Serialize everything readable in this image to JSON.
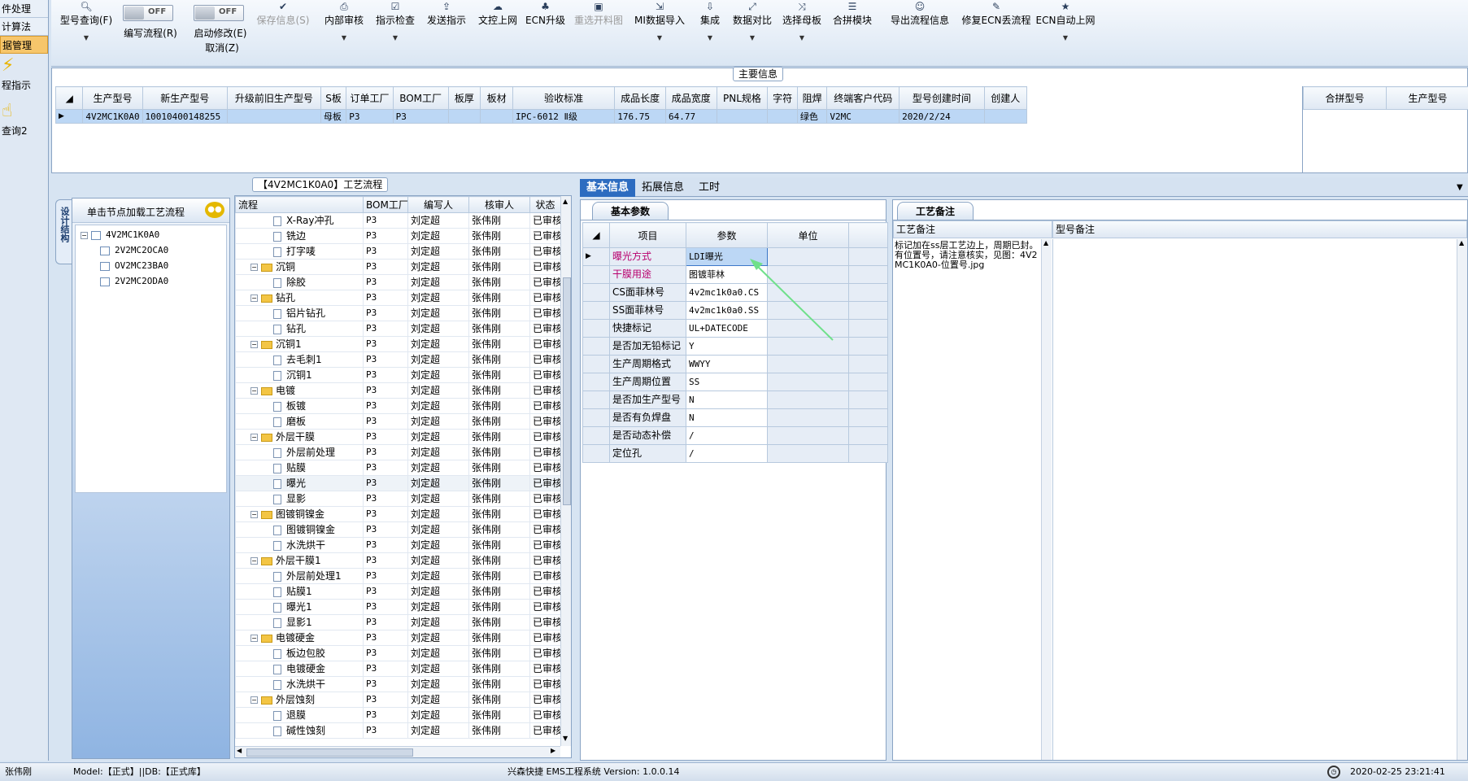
{
  "left_nav": {
    "items": [
      "件处理",
      "计算法",
      "据管理"
    ],
    "icon_items": [
      "程指示",
      "查询2"
    ]
  },
  "toolbar": {
    "query": "型号查询(F)",
    "write_flow": "编写流程(R)",
    "auto_modify": "启动修改(E)",
    "cancel": "取消(Z)",
    "save_info": "保存信息(S)",
    "internal_review": "内部审核",
    "indicator_check": "指示检查",
    "send_indicator": "发送指示",
    "text_upload": "文控上网",
    "ecn_upgrade": "ECN升级",
    "reselect_image": "重选开料图",
    "mi_import": "MI数据导入",
    "integrate": "集成",
    "data_compare": "数据对比",
    "select_mother": "选择母板",
    "merge_module": "合拼模块",
    "export_flow": "导出流程信息",
    "fix_ecn": "修复ECN丢流程",
    "ecn_auto": "ECN自动上网",
    "toggle_off": "OFF"
  },
  "main_info": {
    "title": "主要信息",
    "columns": [
      "生产型号",
      "新生产型号",
      "升级前旧生产型号",
      "S板",
      "订单工厂",
      "BOM工厂",
      "板厚",
      "板材",
      "验收标准",
      "成品长度",
      "成品宽度",
      "PNL规格",
      "字符",
      "阻焊",
      "终端客户代码",
      "型号创建时间",
      "创建人"
    ],
    "row": [
      "4V2MC1K0A0",
      "10010400148255",
      "",
      "母板",
      "P3",
      "P3",
      "",
      "",
      "IPC-6012 Ⅱ级",
      "176.75",
      "64.77",
      "",
      "",
      "绿色",
      "V2MC",
      "2020/2/24",
      ""
    ],
    "merge_columns": [
      "合拼型号",
      "生产型号"
    ]
  },
  "process": {
    "title": "【4V2MC1K0A0】工艺流程",
    "side_tab": "设计结构",
    "hint": "单击节点加载工艺流程",
    "tree": [
      "4V2MC1K0A0",
      "2V2MC2OCA0",
      "OV2MC23BA0",
      "2V2MC2ODA0"
    ],
    "columns": [
      "流程",
      "BOM工厂",
      "编写人",
      "核审人",
      "状态"
    ],
    "rows": [
      {
        "name": "X-Ray冲孔",
        "level": 1,
        "folder": false
      },
      {
        "name": "铣边",
        "level": 1,
        "folder": false
      },
      {
        "name": "打字唛",
        "level": 1,
        "folder": false
      },
      {
        "name": "沉铜",
        "level": 0,
        "folder": true
      },
      {
        "name": "除胶",
        "level": 1,
        "folder": false
      },
      {
        "name": "钻孔",
        "level": 0,
        "folder": true
      },
      {
        "name": "铝片钻孔",
        "level": 1,
        "folder": false
      },
      {
        "name": "钻孔",
        "level": 1,
        "folder": false
      },
      {
        "name": "沉铜1",
        "level": 0,
        "folder": true
      },
      {
        "name": "去毛刺1",
        "level": 1,
        "folder": false
      },
      {
        "name": "沉铜1",
        "level": 1,
        "folder": false
      },
      {
        "name": "电镀",
        "level": 0,
        "folder": true
      },
      {
        "name": "板镀",
        "level": 1,
        "folder": false
      },
      {
        "name": "磨板",
        "level": 1,
        "folder": false
      },
      {
        "name": "外层干膜",
        "level": 0,
        "folder": true
      },
      {
        "name": "外层前处理",
        "level": 1,
        "folder": false
      },
      {
        "name": "贴膜",
        "level": 1,
        "folder": false
      },
      {
        "name": "曝光",
        "level": 1,
        "folder": false
      },
      {
        "name": "显影",
        "level": 1,
        "folder": false
      },
      {
        "name": "图镀铜镍金",
        "level": 0,
        "folder": true
      },
      {
        "name": "图镀铜镍金",
        "level": 1,
        "folder": false
      },
      {
        "name": "水洗烘干",
        "level": 1,
        "folder": false
      },
      {
        "name": "外层干膜1",
        "level": 0,
        "folder": true
      },
      {
        "name": "外层前处理1",
        "level": 1,
        "folder": false
      },
      {
        "name": "贴膜1",
        "level": 1,
        "folder": false
      },
      {
        "name": "曝光1",
        "level": 1,
        "folder": false
      },
      {
        "name": "显影1",
        "level": 1,
        "folder": false
      },
      {
        "name": "电镀硬金",
        "level": 0,
        "folder": true
      },
      {
        "name": "板边包胶",
        "level": 1,
        "folder": false
      },
      {
        "name": "电镀硬金",
        "level": 1,
        "folder": false
      },
      {
        "name": "水洗烘干",
        "level": 1,
        "folder": false
      },
      {
        "name": "外层蚀刻",
        "level": 0,
        "folder": true
      },
      {
        "name": "退膜",
        "level": 1,
        "folder": false
      },
      {
        "name": "碱性蚀刻",
        "level": 1,
        "folder": false
      }
    ],
    "bom": "P3",
    "writer": "刘定超",
    "reviewer": "张伟刚",
    "status": "已审核"
  },
  "right_tabs": [
    "基本信息",
    "拓展信息",
    "工时"
  ],
  "basic": {
    "tab": "基本参数",
    "columns": [
      "项目",
      "参数",
      "单位"
    ],
    "rows": [
      [
        "曝光方式",
        "LDI曝光",
        ""
      ],
      [
        "干膜用途",
        "图镀菲林",
        ""
      ],
      [
        "CS面菲林号",
        "4v2mc1k0a0.CS",
        ""
      ],
      [
        "SS面菲林号",
        "4v2mc1k0a0.SS",
        ""
      ],
      [
        "快捷标记",
        "UL+DATECODE",
        ""
      ],
      [
        "是否加无铅标记",
        "Y",
        ""
      ],
      [
        "生产周期格式",
        "WWYY",
        ""
      ],
      [
        "生产周期位置",
        "SS",
        ""
      ],
      [
        "是否加生产型号",
        "N",
        ""
      ],
      [
        "是否有负焊盘",
        "N",
        ""
      ],
      [
        "是否动态补偿",
        "/",
        ""
      ],
      [
        "定位孔",
        "/",
        ""
      ]
    ]
  },
  "notes": {
    "tab": "工艺备注",
    "col1": "工艺备注",
    "col2": "型号备注",
    "text": "标记加在ss层工艺边上，周期已封。有位置号，请注意核实，见图：4V2MC1K0A0-位置号.jpg"
  },
  "status": {
    "user": "张伟刚",
    "model": "Model:【正式】||DB:【正式库】",
    "system": "兴森快捷 EMS工程系统 Version: 1.0.0.14",
    "time": "2020-02-25 23:21:41"
  },
  "colors": {
    "accent": "#2d6cc0",
    "highlight_text": "#b8006e",
    "selected_row": "#bcd7f5",
    "arrow": "#6fe08a"
  }
}
